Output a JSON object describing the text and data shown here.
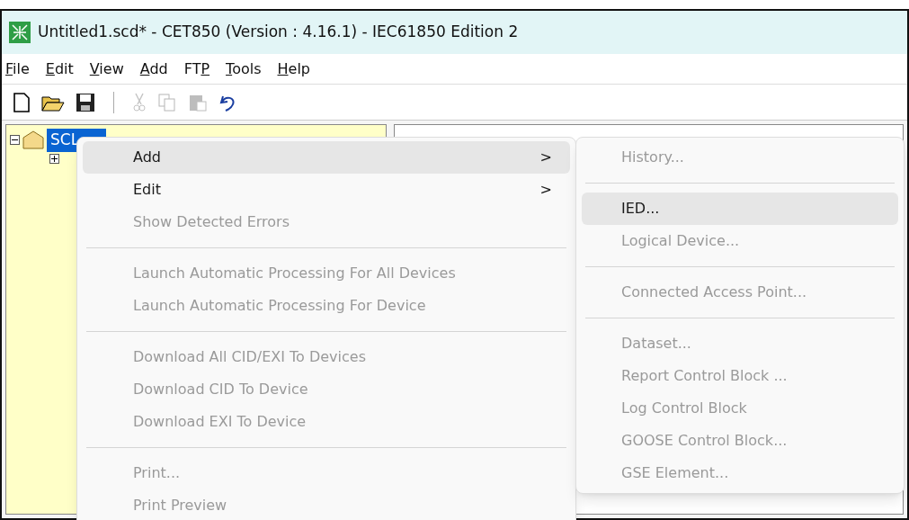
{
  "window": {
    "title": "Untitled1.scd* - CET850 (Version : 4.16.1) - IEC61850 Edition 2"
  },
  "menu_bar": [
    {
      "mnemonic": "F",
      "rest": "ile"
    },
    {
      "mnemonic": "E",
      "rest": "dit"
    },
    {
      "mnemonic": "V",
      "rest": "iew"
    },
    {
      "mnemonic": "A",
      "rest": "dd"
    },
    {
      "start": "FT",
      "mnemonic": "P"
    },
    {
      "mnemonic": "T",
      "rest": "ools"
    },
    {
      "mnemonic": "H",
      "rest": "elp"
    }
  ],
  "toolbar": [
    {
      "kind": "new",
      "disabled": false
    },
    {
      "kind": "open",
      "disabled": false
    },
    {
      "kind": "save",
      "disabled": false
    },
    {
      "kind": "separator"
    },
    {
      "kind": "cut",
      "disabled": true
    },
    {
      "kind": "copy",
      "disabled": true
    },
    {
      "kind": "paste",
      "disabled": true
    },
    {
      "kind": "undo",
      "disabled": false
    }
  ],
  "tree": {
    "root": {
      "label": "SCL",
      "selected": true,
      "expanded": true,
      "children": [
        {
          "expanded": false
        }
      ]
    }
  },
  "context_menu": [
    {
      "kind": "item",
      "label": "Add",
      "submenu_arrow": ">",
      "disabled": false,
      "highlighted": true
    },
    {
      "kind": "item",
      "label": "Edit",
      "submenu_arrow": ">",
      "disabled": false,
      "highlighted": false
    },
    {
      "kind": "item",
      "label": "Show Detected Errors",
      "disabled": true,
      "highlighted": false
    },
    {
      "kind": "separator"
    },
    {
      "kind": "item",
      "label": "Launch Automatic Processing For All Devices",
      "disabled": true,
      "highlighted": false
    },
    {
      "kind": "item",
      "label": "Launch Automatic Processing For Device",
      "disabled": true,
      "highlighted": false
    },
    {
      "kind": "separator"
    },
    {
      "kind": "item",
      "label": "Download All CID/EXI To Devices",
      "disabled": true,
      "highlighted": false
    },
    {
      "kind": "item",
      "label": "Download CID To Device",
      "disabled": true,
      "highlighted": false
    },
    {
      "kind": "item",
      "label": "Download EXI To Device",
      "disabled": true,
      "highlighted": false
    },
    {
      "kind": "separator"
    },
    {
      "kind": "item",
      "label": "Print...",
      "disabled": true,
      "highlighted": false
    },
    {
      "kind": "item",
      "label": "Print Preview",
      "disabled": true,
      "highlighted": false
    }
  ],
  "submenu": [
    {
      "kind": "item",
      "label": "History...",
      "disabled": true,
      "highlighted": false
    },
    {
      "kind": "separator"
    },
    {
      "kind": "item",
      "label": "IED...",
      "disabled": false,
      "highlighted": true
    },
    {
      "kind": "item",
      "label": "Logical Device...",
      "disabled": true,
      "highlighted": false
    },
    {
      "kind": "separator"
    },
    {
      "kind": "item",
      "label": "Connected Access Point...",
      "disabled": true,
      "highlighted": false
    },
    {
      "kind": "separator"
    },
    {
      "kind": "item",
      "label": "Dataset...",
      "disabled": true,
      "highlighted": false
    },
    {
      "kind": "item",
      "label": "Report Control Block ...",
      "disabled": true,
      "highlighted": false
    },
    {
      "kind": "item",
      "label": "Log Control Block",
      "disabled": true,
      "highlighted": false
    },
    {
      "kind": "item",
      "label": "GOOSE Control Block...",
      "disabled": true,
      "highlighted": false
    },
    {
      "kind": "item",
      "label": "GSE Element...",
      "disabled": true,
      "highlighted": false
    }
  ]
}
